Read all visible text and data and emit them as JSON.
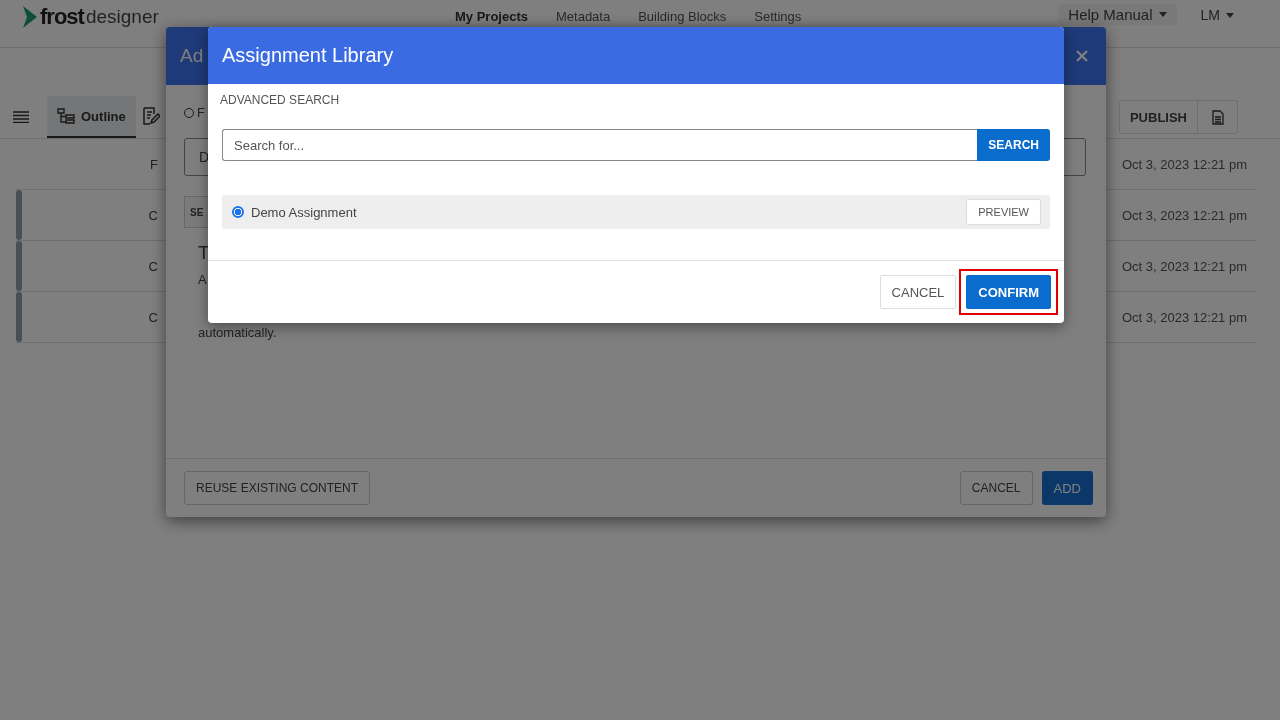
{
  "header": {
    "logo": {
      "brand": "frost",
      "suffix": "designer"
    },
    "nav": [
      {
        "label": "My Projects",
        "selected": true
      },
      {
        "label": "Metadata",
        "selected": false
      },
      {
        "label": "Building Blocks",
        "selected": false
      },
      {
        "label": "Settings",
        "selected": false
      }
    ],
    "help": "Help Manual",
    "user": "LM"
  },
  "toolbar": {
    "tabs": [
      {
        "kind": "outline",
        "label": "Outline",
        "selected": true
      },
      {
        "kind": "edit",
        "selected": false
      }
    ],
    "publish": "PUBLISH"
  },
  "rows": [
    {
      "column_1": "F",
      "date": "Oct 3, 2023 12:21 pm",
      "flagged": false
    },
    {
      "column_1": "C",
      "date": "Oct 3, 2023 12:21 pm",
      "flagged": true
    },
    {
      "column_1": "C",
      "date": "Oct 3, 2023 12:21 pm",
      "flagged": true
    },
    {
      "column_1": "C",
      "date": "Oct 3, 2023 12:21 pm",
      "flagged": true
    }
  ],
  "add_dialog": {
    "title": "Ad",
    "radio": {
      "label": "F",
      "selected": false
    },
    "field_value": "D",
    "button": "SE",
    "heading": "T",
    "paragraph": [
      "A",
      "automatically."
    ],
    "reuse": "REUSE EXISTING CONTENT",
    "cancel": "CANCEL",
    "add": "ADD"
  },
  "library_dialog": {
    "title": "Assignment Library",
    "section": "ADVANCED SEARCH",
    "search": {
      "placeholder": "Search for...",
      "button": "SEARCH"
    },
    "results": [
      {
        "label": "Demo Assignment",
        "selected": true,
        "preview": "PREVIEW"
      }
    ],
    "cancel": "CANCEL",
    "confirm": "CONFIRM",
    "confirm_highlighted": true
  }
}
